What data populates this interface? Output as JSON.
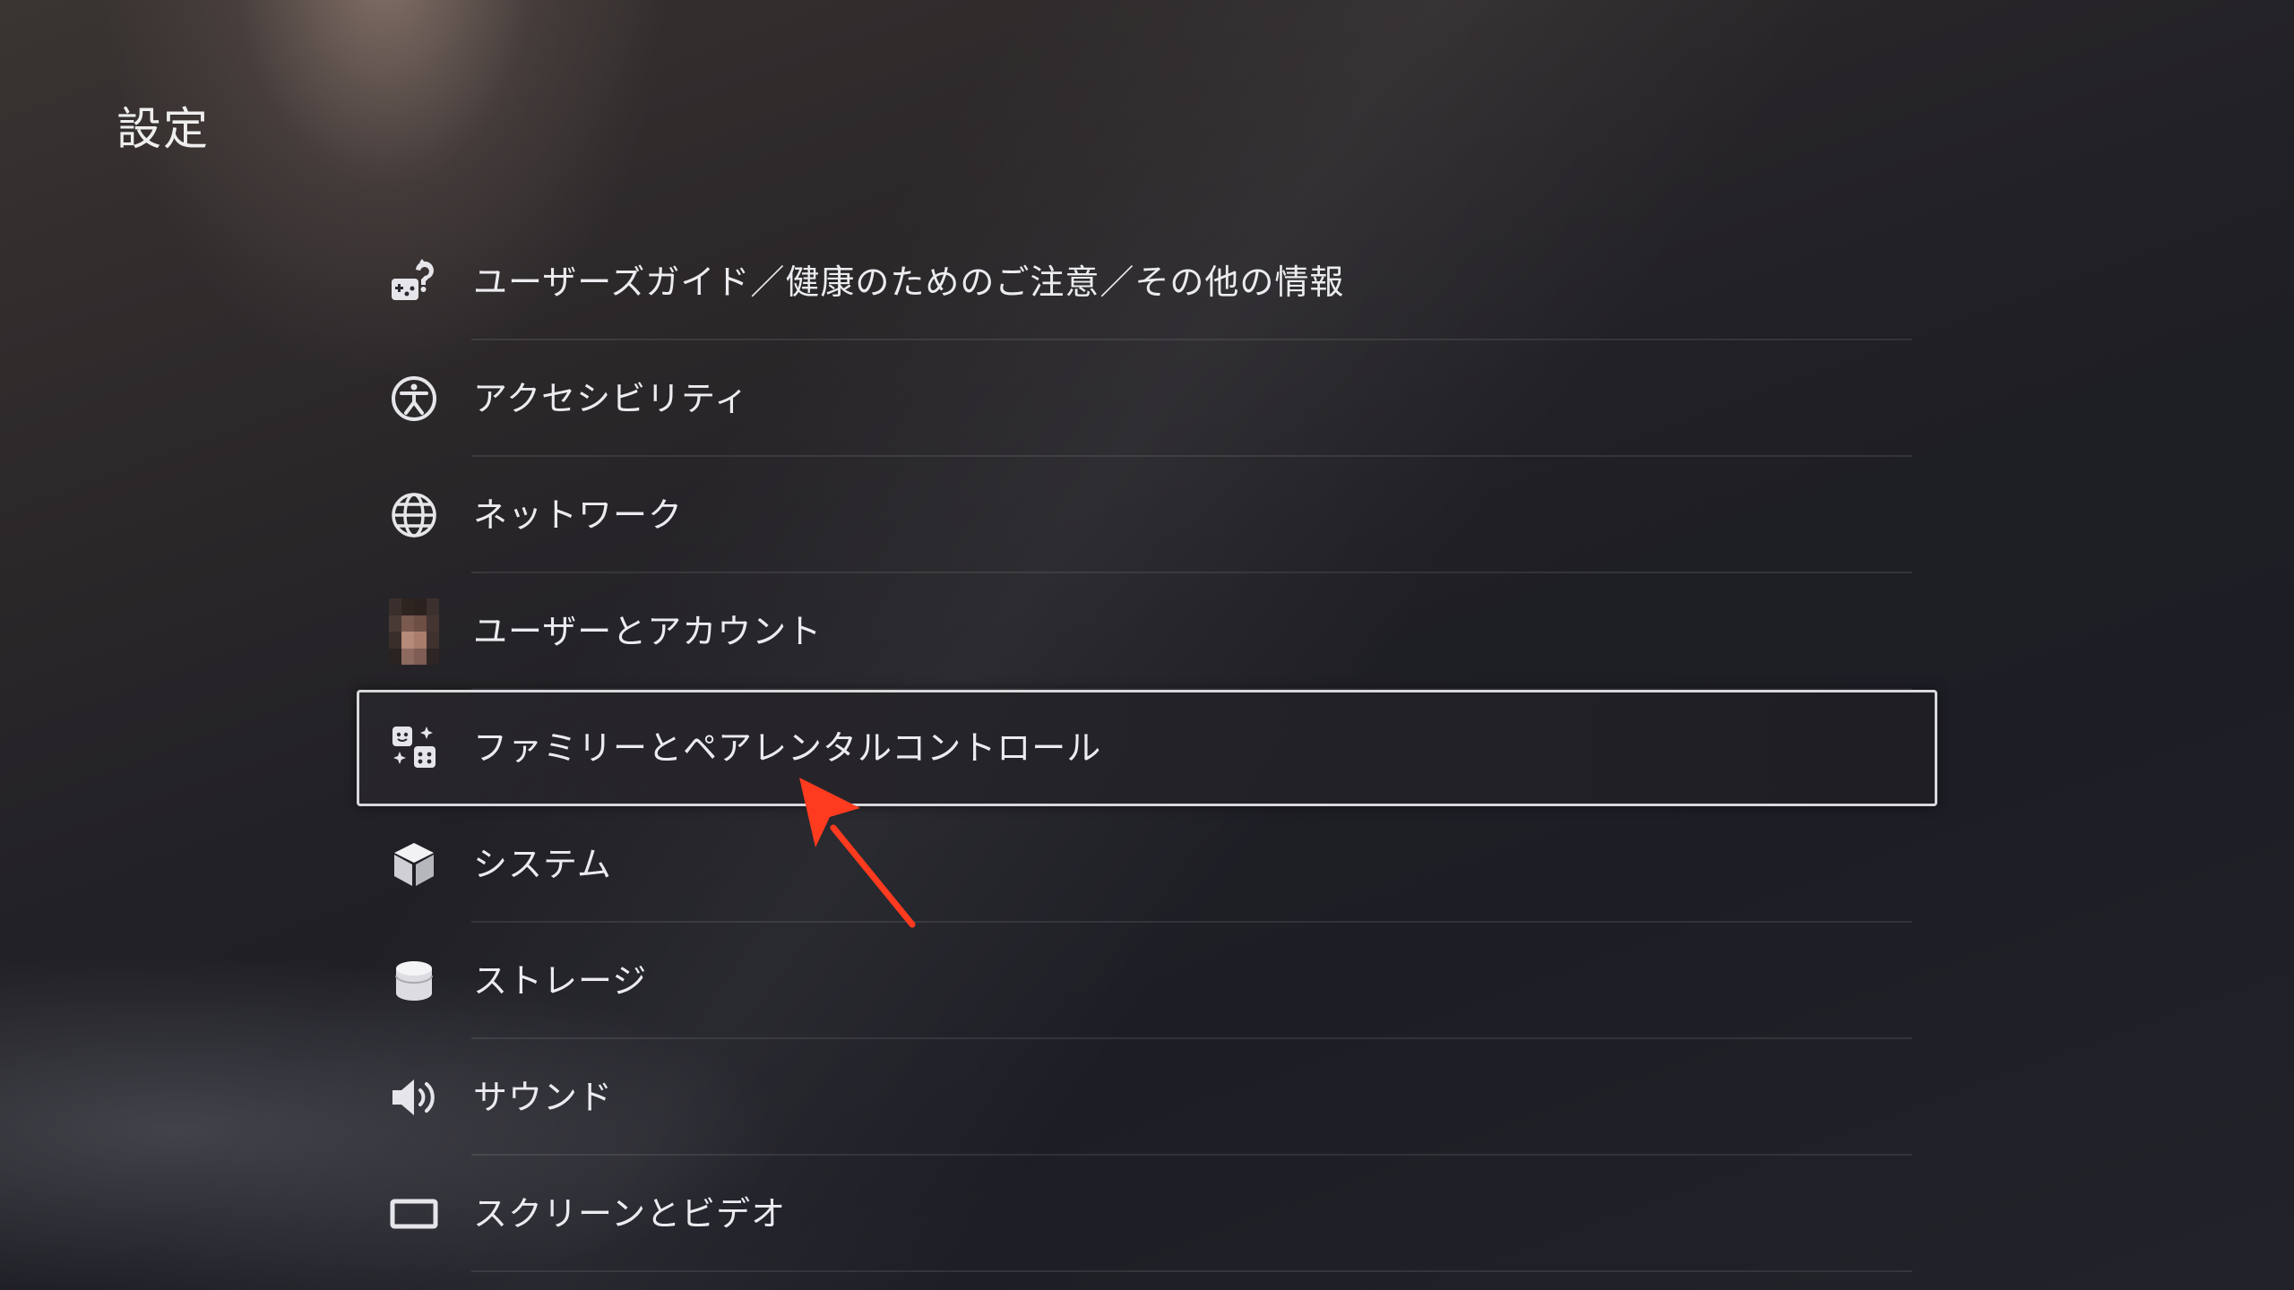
{
  "page": {
    "title": "設定"
  },
  "settings": {
    "items": [
      {
        "label": "ユーザーズガイド／健康のためのご注意／その他の情報",
        "icon": "user-guide-icon"
      },
      {
        "label": "アクセシビリティ",
        "icon": "accessibility-icon"
      },
      {
        "label": "ネットワーク",
        "icon": "globe-icon"
      },
      {
        "label": "ユーザーとアカウント",
        "icon": "avatar"
      },
      {
        "label": "ファミリーとペアレンタルコントロール",
        "icon": "family-icon",
        "selected": true
      },
      {
        "label": "システム",
        "icon": "cube-icon"
      },
      {
        "label": "ストレージ",
        "icon": "storage-icon"
      },
      {
        "label": "サウンド",
        "icon": "speaker-icon"
      },
      {
        "label": "スクリーンとビデオ",
        "icon": "screen-icon"
      }
    ]
  },
  "colors": {
    "highlight_border": "#d8d8dc",
    "annotation_arrow": "#ff3b1f",
    "text": "#ececf0"
  }
}
